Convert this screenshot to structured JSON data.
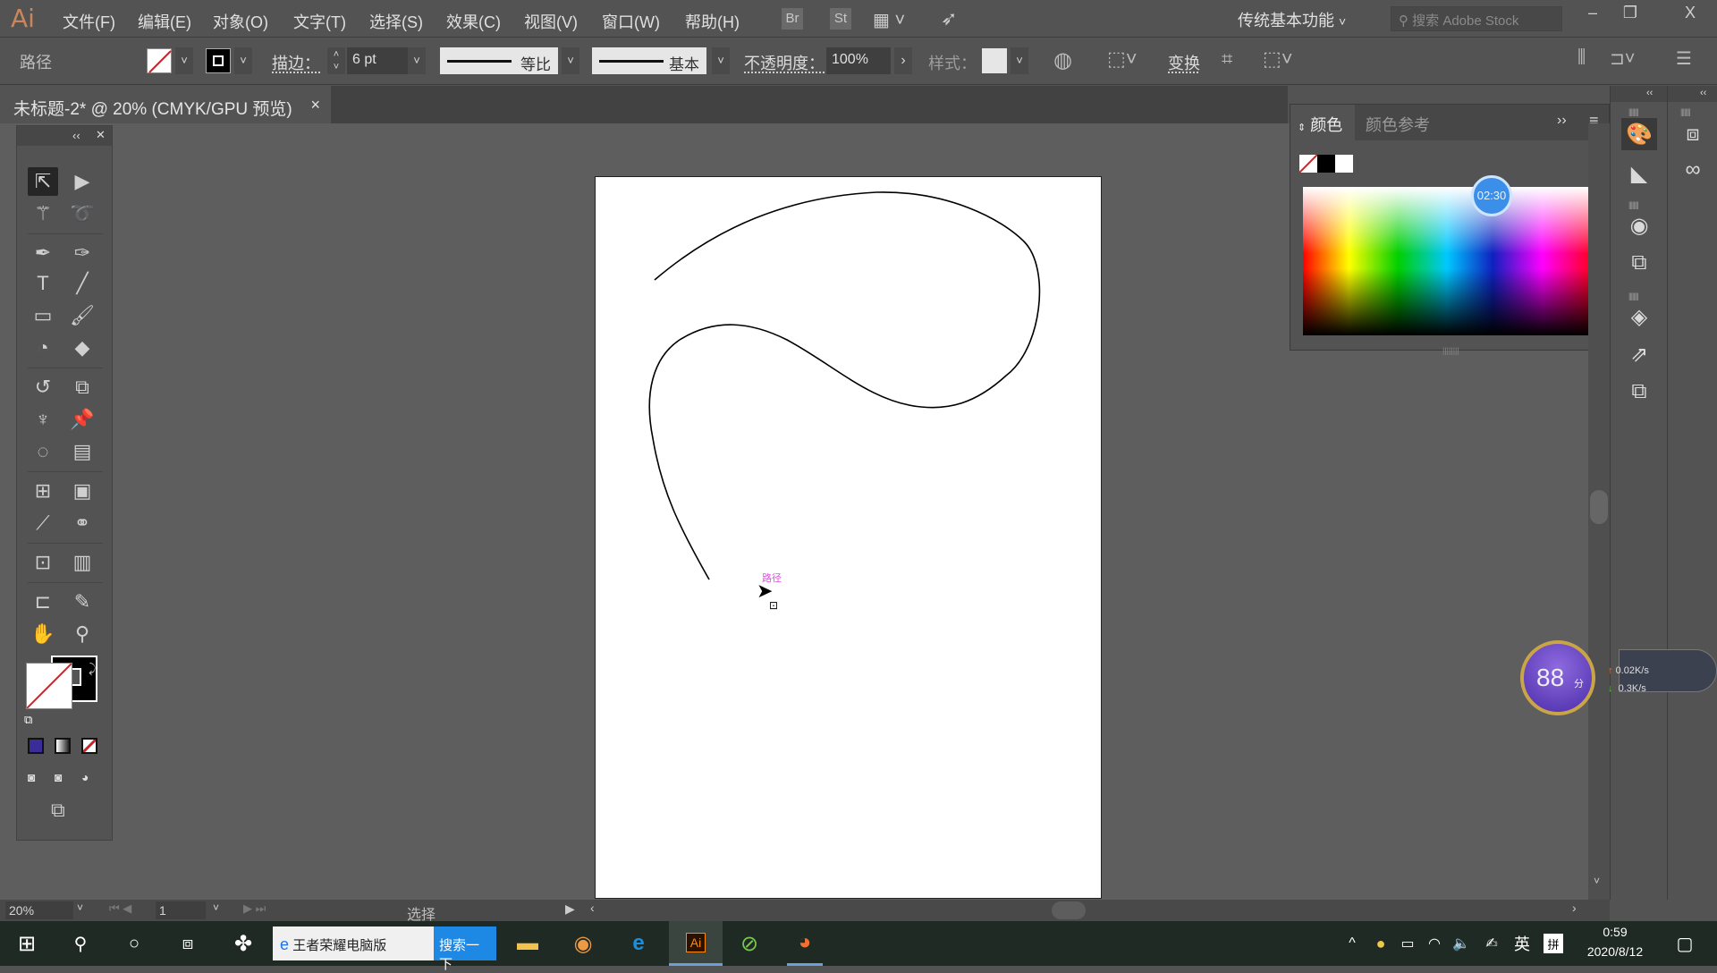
{
  "app": {
    "logo": "Ai",
    "workspace": "传统基本功能",
    "stock_placeholder": "搜索 Adobe Stock"
  },
  "menu": [
    "文件(F)",
    "编辑(E)",
    "对象(O)",
    "文字(T)",
    "选择(S)",
    "效果(C)",
    "视图(V)",
    "窗口(W)",
    "帮助(H)"
  ],
  "topbar_buttons": {
    "bridge": "Br",
    "stock": "St"
  },
  "window_controls": {
    "minimize": "–",
    "restore": "❐",
    "close": "X"
  },
  "control": {
    "selection_type": "路径",
    "stroke_label": "描边：",
    "stroke_weight": "6 pt",
    "variable_width": "等比",
    "brush": "基本",
    "opacity_label": "不透明度：",
    "opacity": "100%",
    "style_label": "样式：",
    "transform_label": "变换"
  },
  "document_tab": {
    "title": "未标题-2* @ 20% (CMYK/GPU 预览)",
    "close": "×"
  },
  "canvas": {
    "hover_label": "路径"
  },
  "color_panel": {
    "tab_active": "颜色",
    "tab_other": "颜色参考",
    "accent_swatches": [
      "none",
      "#000000",
      "#ffffff"
    ]
  },
  "overlay_timer": "02:30",
  "net_widget": {
    "score": "88",
    "unit": "分",
    "upload": "0.02K/s",
    "download": "0.3K/s"
  },
  "status": {
    "zoom": "20%",
    "artboard": "1",
    "tool": "选择"
  },
  "taskbar": {
    "search_text": "王者荣耀电脑版",
    "search_button": "搜索一下",
    "ime_lang": "英",
    "ime_mode": "拼",
    "time": "0:59",
    "date": "2020/8/12"
  },
  "colors": {
    "fill_none_slash": "#c0282d",
    "fill_swatch_blue": "#3a2d9a",
    "pink_label": "#e050e0"
  }
}
